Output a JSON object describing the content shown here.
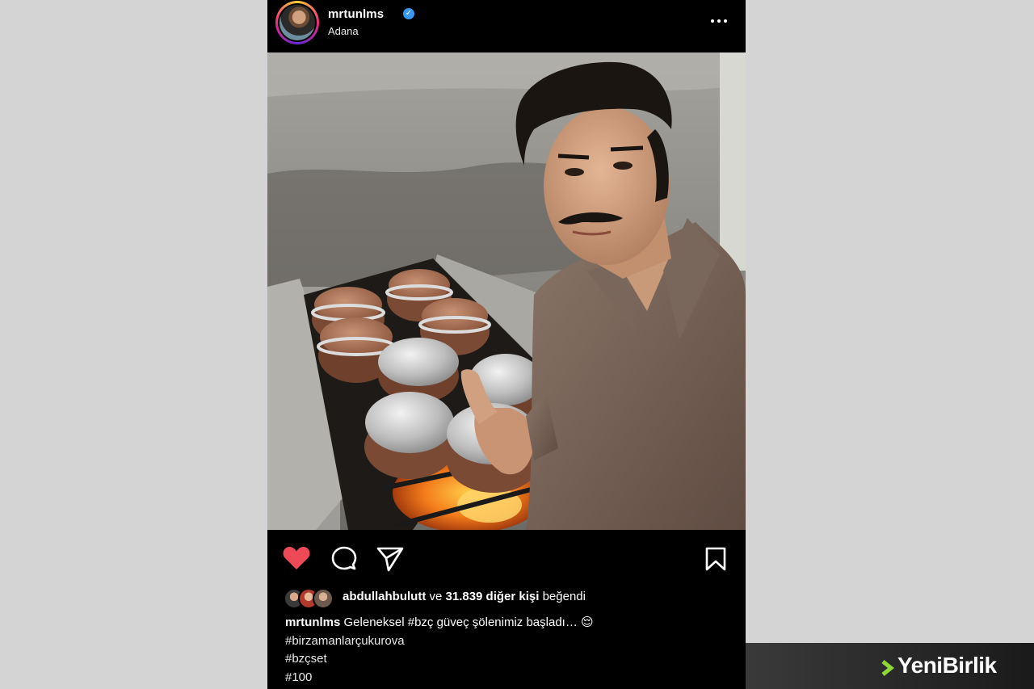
{
  "post": {
    "username": "mrtunlms",
    "location": "Adana",
    "likes": {
      "liker": "abdullahbulutt",
      "connector": "ve",
      "others": "31.839 diğer kişi",
      "suffix": "beğendi"
    },
    "caption": {
      "user": "mrtunlms",
      "text": "Geleneksel #bzç güveç şölenimiz başladı… 😌",
      "hashtags": [
        "#birzamanlarçukurova",
        "#bzçset",
        "#100"
      ]
    }
  },
  "icons": {
    "verified": "verified-badge-icon",
    "more": "more-options-icon",
    "like": "heart-icon",
    "comment": "comment-icon",
    "share": "send-icon",
    "save": "bookmark-icon"
  },
  "colors": {
    "like": "#ed4956",
    "verified": "#3897f0",
    "background": "#000000",
    "accent_green": "#8ed73a"
  },
  "watermark": {
    "brand": "YeniBirlik"
  }
}
